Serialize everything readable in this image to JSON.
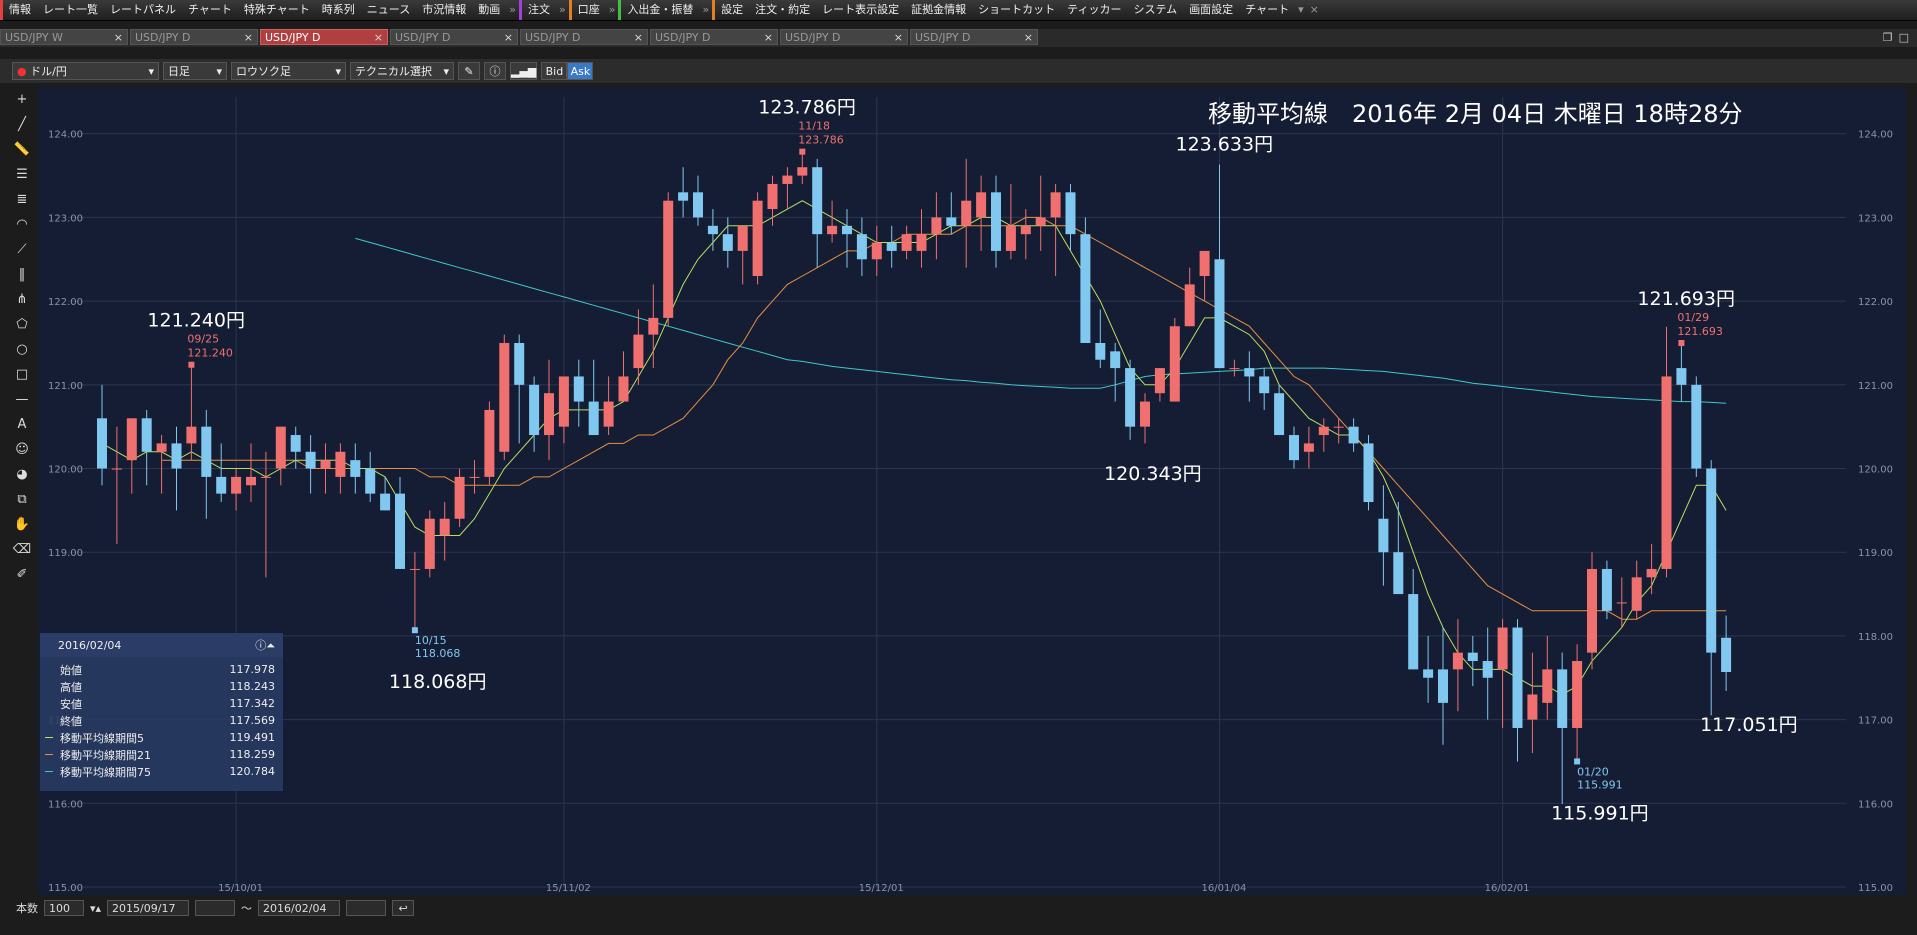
{
  "menu": {
    "items": [
      {
        "label": "情報",
        "accent": "#e04040"
      },
      {
        "label": "レート一覧"
      },
      {
        "label": "レートパネル"
      },
      {
        "label": "チャート"
      },
      {
        "label": "特殊チャート"
      },
      {
        "label": "時系列"
      },
      {
        "label": "ニュース"
      },
      {
        "label": "市況情報"
      },
      {
        "label": "動画"
      },
      {
        "label": "»",
        "sep": true
      },
      {
        "label": "注文",
        "accent": "#a040e0"
      },
      {
        "label": "»",
        "sep": true
      },
      {
        "label": "口座",
        "accent": "#e08020"
      },
      {
        "label": "»",
        "sep": true
      },
      {
        "label": "入出金・振替",
        "accent": "#40c040"
      },
      {
        "label": "»",
        "sep": true
      },
      {
        "label": "設定",
        "accent": "#e08020"
      },
      {
        "label": "注文・約定"
      },
      {
        "label": "レート表示設定"
      },
      {
        "label": "証拠金情報"
      },
      {
        "label": "ショートカット"
      },
      {
        "label": "ティッカー"
      },
      {
        "label": "システム"
      },
      {
        "label": "画面設定"
      },
      {
        "label": "チャート"
      },
      {
        "label": "▾",
        "sep": true
      },
      {
        "label": "×",
        "sep": true
      }
    ]
  },
  "tabs": [
    {
      "label": "USD/JPY W",
      "active": false
    },
    {
      "label": "USD/JPY D",
      "active": false
    },
    {
      "label": "USD/JPY D",
      "active": true
    },
    {
      "label": "USD/JPY D",
      "active": false
    },
    {
      "label": "USD/JPY D",
      "active": false
    },
    {
      "label": "USD/JPY D",
      "active": false
    },
    {
      "label": "USD/JPY D",
      "active": false
    },
    {
      "label": "USD/JPY D",
      "active": false
    }
  ],
  "tab_close": "×",
  "toolbar": {
    "pair": "ドル/円",
    "period": "日足",
    "chart_type": "ロウソク足",
    "technical": "テクニカル選択",
    "bid": "Bid",
    "ask": "Ask"
  },
  "chart_data": {
    "type": "candlestick",
    "title": "移動平均線　2016年 2月 04日 木曜日 18時28分",
    "ylim": [
      115.0,
      124.2
    ],
    "yticks": [
      "124.00",
      "123.00",
      "122.00",
      "121.00",
      "120.00",
      "119.00",
      "118.00",
      "117.00",
      "116.00",
      "115.00"
    ],
    "xticks": [
      {
        "label": "15/10/01",
        "index": 9
      },
      {
        "label": "15/11/02",
        "index": 31
      },
      {
        "label": "15/12/01",
        "index": 52
      },
      {
        "label": "16/01/04",
        "index": 75
      },
      {
        "label": "16/02/01",
        "index": 94
      }
    ],
    "colors": {
      "up": "#f07070",
      "down": "#80c8f0",
      "ma5": "#b8e060",
      "ma21": "#e89040",
      "ma75": "#40c8c8"
    },
    "candles": [
      {
        "o": 120.6,
        "h": 121.0,
        "l": 119.8,
        "c": 120.0
      },
      {
        "o": 120.0,
        "h": 120.5,
        "l": 119.1,
        "c": 120.0
      },
      {
        "o": 120.1,
        "h": 120.6,
        "l": 119.7,
        "c": 120.6
      },
      {
        "o": 120.6,
        "h": 120.7,
        "l": 119.8,
        "c": 120.2
      },
      {
        "o": 120.2,
        "h": 120.4,
        "l": 119.7,
        "c": 120.3
      },
      {
        "o": 120.3,
        "h": 120.5,
        "l": 119.5,
        "c": 120.0
      },
      {
        "o": 120.3,
        "h": 121.24,
        "l": 120.1,
        "c": 120.5
      },
      {
        "o": 120.5,
        "h": 120.7,
        "l": 119.4,
        "c": 119.9
      },
      {
        "o": 119.9,
        "h": 120.3,
        "l": 119.6,
        "c": 119.7
      },
      {
        "o": 119.7,
        "h": 120.0,
        "l": 119.5,
        "c": 119.9
      },
      {
        "o": 119.8,
        "h": 120.3,
        "l": 119.6,
        "c": 119.9
      },
      {
        "o": 119.9,
        "h": 120.2,
        "l": 118.7,
        "c": 119.9
      },
      {
        "o": 120.0,
        "h": 120.5,
        "l": 119.8,
        "c": 120.5
      },
      {
        "o": 120.4,
        "h": 120.5,
        "l": 120.0,
        "c": 120.2
      },
      {
        "o": 120.2,
        "h": 120.4,
        "l": 119.7,
        "c": 120.0
      },
      {
        "o": 120.0,
        "h": 120.3,
        "l": 119.7,
        "c": 120.1
      },
      {
        "o": 119.9,
        "h": 120.3,
        "l": 119.7,
        "c": 120.2
      },
      {
        "o": 120.1,
        "h": 120.3,
        "l": 119.7,
        "c": 119.9
      },
      {
        "o": 120.0,
        "h": 120.2,
        "l": 119.6,
        "c": 119.7
      },
      {
        "o": 119.7,
        "h": 119.9,
        "l": 119.5,
        "c": 119.5
      },
      {
        "o": 119.7,
        "h": 119.9,
        "l": 118.8,
        "c": 118.8
      },
      {
        "o": 118.8,
        "h": 119.0,
        "l": 118.068,
        "c": 118.8
      },
      {
        "o": 118.8,
        "h": 119.5,
        "l": 118.7,
        "c": 119.4
      },
      {
        "o": 119.2,
        "h": 119.6,
        "l": 118.9,
        "c": 119.4
      },
      {
        "o": 119.4,
        "h": 120.0,
        "l": 119.3,
        "c": 119.9
      },
      {
        "o": 119.9,
        "h": 120.1,
        "l": 119.7,
        "c": 119.9
      },
      {
        "o": 119.9,
        "h": 120.8,
        "l": 119.8,
        "c": 120.7
      },
      {
        "o": 120.2,
        "h": 121.6,
        "l": 120.1,
        "c": 121.5
      },
      {
        "o": 121.5,
        "h": 121.6,
        "l": 120.3,
        "c": 121.0
      },
      {
        "o": 121.0,
        "h": 121.1,
        "l": 120.2,
        "c": 120.4
      },
      {
        "o": 120.4,
        "h": 121.3,
        "l": 120.1,
        "c": 120.9
      },
      {
        "o": 120.5,
        "h": 121.1,
        "l": 120.3,
        "c": 121.1
      },
      {
        "o": 121.1,
        "h": 121.3,
        "l": 120.5,
        "c": 120.8
      },
      {
        "o": 120.8,
        "h": 121.3,
        "l": 120.4,
        "c": 120.4
      },
      {
        "o": 120.5,
        "h": 121.1,
        "l": 120.4,
        "c": 120.8
      },
      {
        "o": 120.8,
        "h": 121.4,
        "l": 120.8,
        "c": 121.1
      },
      {
        "o": 121.2,
        "h": 121.9,
        "l": 121.0,
        "c": 121.6
      },
      {
        "o": 121.6,
        "h": 122.2,
        "l": 121.2,
        "c": 121.8
      },
      {
        "o": 121.8,
        "h": 123.3,
        "l": 121.7,
        "c": 123.2
      },
      {
        "o": 123.3,
        "h": 123.6,
        "l": 123.0,
        "c": 123.2
      },
      {
        "o": 123.3,
        "h": 123.5,
        "l": 122.9,
        "c": 123.0
      },
      {
        "o": 122.9,
        "h": 123.1,
        "l": 122.6,
        "c": 122.8
      },
      {
        "o": 122.8,
        "h": 123.0,
        "l": 122.4,
        "c": 122.6
      },
      {
        "o": 122.6,
        "h": 122.8,
        "l": 122.2,
        "c": 122.9
      },
      {
        "o": 122.3,
        "h": 123.3,
        "l": 122.2,
        "c": 123.2
      },
      {
        "o": 123.1,
        "h": 123.5,
        "l": 122.9,
        "c": 123.4
      },
      {
        "o": 123.4,
        "h": 123.6,
        "l": 123.1,
        "c": 123.5
      },
      {
        "o": 123.5,
        "h": 123.786,
        "l": 123.4,
        "c": 123.6
      },
      {
        "o": 123.6,
        "h": 123.7,
        "l": 122.4,
        "c": 122.8
      },
      {
        "o": 122.8,
        "h": 123.2,
        "l": 122.7,
        "c": 122.9
      },
      {
        "o": 122.9,
        "h": 123.1,
        "l": 122.4,
        "c": 122.8
      },
      {
        "o": 122.8,
        "h": 123.0,
        "l": 122.3,
        "c": 122.5
      },
      {
        "o": 122.5,
        "h": 122.9,
        "l": 122.3,
        "c": 122.7
      },
      {
        "o": 122.7,
        "h": 122.9,
        "l": 122.4,
        "c": 122.6
      },
      {
        "o": 122.6,
        "h": 122.9,
        "l": 122.5,
        "c": 122.8
      },
      {
        "o": 122.6,
        "h": 123.1,
        "l": 122.4,
        "c": 122.8
      },
      {
        "o": 122.8,
        "h": 123.3,
        "l": 122.5,
        "c": 123.0
      },
      {
        "o": 123.0,
        "h": 123.3,
        "l": 122.8,
        "c": 122.9
      },
      {
        "o": 122.9,
        "h": 123.7,
        "l": 122.4,
        "c": 123.2
      },
      {
        "o": 123.0,
        "h": 123.5,
        "l": 122.6,
        "c": 123.3
      },
      {
        "o": 123.3,
        "h": 123.5,
        "l": 122.4,
        "c": 122.6
      },
      {
        "o": 122.6,
        "h": 123.4,
        "l": 122.5,
        "c": 122.9
      },
      {
        "o": 122.8,
        "h": 123.1,
        "l": 122.5,
        "c": 122.9
      },
      {
        "o": 122.9,
        "h": 123.5,
        "l": 122.6,
        "c": 123.0
      },
      {
        "o": 123.0,
        "h": 123.4,
        "l": 122.3,
        "c": 123.3
      },
      {
        "o": 123.3,
        "h": 123.4,
        "l": 122.6,
        "c": 122.8
      },
      {
        "o": 122.8,
        "h": 123.0,
        "l": 121.5,
        "c": 121.5
      },
      {
        "o": 121.5,
        "h": 121.9,
        "l": 121.2,
        "c": 121.3
      },
      {
        "o": 121.4,
        "h": 121.5,
        "l": 120.8,
        "c": 121.2
      },
      {
        "o": 121.2,
        "h": 121.3,
        "l": 120.343,
        "c": 120.5
      },
      {
        "o": 120.5,
        "h": 120.9,
        "l": 120.3,
        "c": 120.8
      },
      {
        "o": 120.9,
        "h": 121.2,
        "l": 120.8,
        "c": 121.2
      },
      {
        "o": 120.8,
        "h": 121.8,
        "l": 120.8,
        "c": 121.7
      },
      {
        "o": 121.7,
        "h": 122.4,
        "l": 121.7,
        "c": 122.2
      },
      {
        "o": 122.3,
        "h": 122.6,
        "l": 122.0,
        "c": 122.6
      },
      {
        "o": 122.5,
        "h": 123.633,
        "l": 121.2,
        "c": 121.2
      },
      {
        "o": 121.2,
        "h": 121.3,
        "l": 121.1,
        "c": 121.2
      },
      {
        "o": 121.2,
        "h": 121.4,
        "l": 120.8,
        "c": 121.1
      },
      {
        "o": 121.1,
        "h": 121.2,
        "l": 120.7,
        "c": 120.9
      },
      {
        "o": 120.9,
        "h": 121.0,
        "l": 120.4,
        "c": 120.4
      },
      {
        "o": 120.4,
        "h": 120.5,
        "l": 120.0,
        "c": 120.1
      },
      {
        "o": 120.2,
        "h": 120.5,
        "l": 120.0,
        "c": 120.3
      },
      {
        "o": 120.4,
        "h": 120.6,
        "l": 120.2,
        "c": 120.5
      },
      {
        "o": 120.5,
        "h": 120.6,
        "l": 120.3,
        "c": 120.5
      },
      {
        "o": 120.5,
        "h": 120.6,
        "l": 120.2,
        "c": 120.3
      },
      {
        "o": 120.3,
        "h": 120.4,
        "l": 119.5,
        "c": 119.6
      },
      {
        "o": 119.4,
        "h": 119.8,
        "l": 118.6,
        "c": 119.0
      },
      {
        "o": 119.0,
        "h": 119.6,
        "l": 118.5,
        "c": 118.5
      },
      {
        "o": 118.5,
        "h": 118.8,
        "l": 117.6,
        "c": 117.6
      },
      {
        "o": 117.6,
        "h": 118.0,
        "l": 117.2,
        "c": 117.5
      },
      {
        "o": 117.6,
        "h": 118.1,
        "l": 116.7,
        "c": 117.2
      },
      {
        "o": 117.6,
        "h": 118.2,
        "l": 117.1,
        "c": 117.8
      },
      {
        "o": 117.8,
        "h": 118.0,
        "l": 117.4,
        "c": 117.7
      },
      {
        "o": 117.7,
        "h": 118.1,
        "l": 117.0,
        "c": 117.5
      },
      {
        "o": 117.6,
        "h": 118.2,
        "l": 116.9,
        "c": 118.1
      },
      {
        "o": 118.1,
        "h": 118.2,
        "l": 116.5,
        "c": 116.9
      },
      {
        "o": 117.0,
        "h": 117.8,
        "l": 116.6,
        "c": 117.3
      },
      {
        "o": 117.2,
        "h": 118.0,
        "l": 117.0,
        "c": 117.6
      },
      {
        "o": 117.6,
        "h": 117.8,
        "l": 115.991,
        "c": 116.9
      },
      {
        "o": 116.9,
        "h": 117.9,
        "l": 116.5,
        "c": 117.7
      },
      {
        "o": 117.8,
        "h": 119.0,
        "l": 117.6,
        "c": 118.8
      },
      {
        "o": 118.8,
        "h": 118.9,
        "l": 118.2,
        "c": 118.3
      },
      {
        "o": 118.4,
        "h": 118.7,
        "l": 118.1,
        "c": 118.4
      },
      {
        "o": 118.3,
        "h": 118.9,
        "l": 118.2,
        "c": 118.7
      },
      {
        "o": 118.7,
        "h": 119.1,
        "l": 118.5,
        "c": 118.8
      },
      {
        "o": 118.8,
        "h": 121.693,
        "l": 118.7,
        "c": 121.1
      },
      {
        "o": 121.2,
        "h": 121.5,
        "l": 120.8,
        "c": 121.0
      },
      {
        "o": 121.0,
        "h": 121.1,
        "l": 119.9,
        "c": 120.0
      },
      {
        "o": 120.0,
        "h": 120.1,
        "l": 117.051,
        "c": 117.8
      },
      {
        "o": 117.978,
        "h": 118.243,
        "l": 117.342,
        "c": 117.569
      }
    ],
    "ma5": [
      120.3,
      120.2,
      120.1,
      120.2,
      120.2,
      120.1,
      120.2,
      120.1,
      120.0,
      120.0,
      120.0,
      119.9,
      120.0,
      120.1,
      120.1,
      120.1,
      120.1,
      120.0,
      120.0,
      119.9,
      119.6,
      119.3,
      119.2,
      119.2,
      119.2,
      119.4,
      119.7,
      120.0,
      120.2,
      120.4,
      120.6,
      120.7,
      120.7,
      120.7,
      120.7,
      120.8,
      121.1,
      121.4,
      121.8,
      122.2,
      122.5,
      122.7,
      122.9,
      122.9,
      122.9,
      123.0,
      123.1,
      123.2,
      123.1,
      123.0,
      122.9,
      122.8,
      122.7,
      122.7,
      122.7,
      122.7,
      122.8,
      122.9,
      122.9,
      123.0,
      123.0,
      122.9,
      122.9,
      122.9,
      122.9,
      122.6,
      122.3,
      122.0,
      121.6,
      121.2,
      121.0,
      121.0,
      121.2,
      121.5,
      121.8,
      121.8,
      121.7,
      121.6,
      121.4,
      121.0,
      120.8,
      120.6,
      120.5,
      120.4,
      120.4,
      120.2,
      119.9,
      119.5,
      119.0,
      118.5,
      118.1,
      117.8,
      117.6,
      117.6,
      117.6,
      117.5,
      117.4,
      117.4,
      117.3,
      117.4,
      117.7,
      117.9,
      118.1,
      118.4,
      118.6,
      119.0,
      119.4,
      119.8,
      119.8,
      119.5
    ],
    "ma21": [
      120.1,
      120.1,
      120.1,
      120.1,
      120.1,
      120.1,
      120.1,
      120.1,
      120.1,
      120.1,
      120.0,
      120.0,
      120.0,
      120.0,
      120.0,
      120.0,
      120.0,
      120.0,
      119.9,
      119.9,
      119.8,
      119.8,
      119.8,
      119.8,
      119.8,
      119.9,
      119.9,
      120.0,
      120.1,
      120.2,
      120.3,
      120.3,
      120.4,
      120.4,
      120.5,
      120.6,
      120.8,
      121.0,
      121.3,
      121.5,
      121.8,
      122.0,
      122.2,
      122.3,
      122.4,
      122.5,
      122.6,
      122.6,
      122.7,
      122.7,
      122.8,
      122.8,
      122.8,
      122.8,
      122.9,
      122.9,
      122.9,
      122.9,
      123.0,
      123.0,
      122.9,
      122.9,
      122.8,
      122.7,
      122.6,
      122.5,
      122.4,
      122.3,
      122.2,
      122.1,
      122.0,
      121.9,
      121.8,
      121.7,
      121.5,
      121.3,
      121.1,
      121.0,
      120.8,
      120.6,
      120.4,
      120.2,
      120.0,
      119.8,
      119.6,
      119.4,
      119.2,
      119.0,
      118.8,
      118.6,
      118.5,
      118.4,
      118.3,
      118.3,
      118.3,
      118.3,
      118.3,
      118.3,
      118.2,
      118.2,
      118.3,
      118.3,
      118.3,
      118.3,
      118.3,
      118.3
    ],
    "ma75": [
      122.75,
      122.7,
      122.65,
      122.6,
      122.55,
      122.5,
      122.45,
      122.4,
      122.35,
      122.3,
      122.25,
      122.2,
      122.15,
      122.1,
      122.05,
      122.0,
      121.95,
      121.9,
      121.85,
      121.8,
      121.75,
      121.7,
      121.65,
      121.6,
      121.55,
      121.5,
      121.45,
      121.4,
      121.35,
      121.3,
      121.28,
      121.25,
      121.22,
      121.2,
      121.18,
      121.16,
      121.14,
      121.12,
      121.1,
      121.08,
      121.06,
      121.05,
      121.03,
      121.02,
      121.0,
      120.99,
      120.98,
      120.97,
      120.96,
      120.96,
      120.96,
      121.0,
      121.05,
      121.1,
      121.12,
      121.13,
      121.14,
      121.15,
      121.16,
      121.17,
      121.18,
      121.2,
      121.2,
      121.2,
      121.2,
      121.2,
      121.19,
      121.18,
      121.17,
      121.16,
      121.14,
      121.12,
      121.1,
      121.08,
      121.05,
      121.02,
      121.0,
      120.98,
      120.96,
      120.94,
      120.92,
      120.9,
      120.88,
      120.86,
      120.85,
      120.84,
      120.83,
      120.82,
      120.81,
      120.8,
      120.8,
      120.79,
      120.78
    ],
    "annotations": [
      {
        "idx": 6,
        "kind": "high",
        "date": "09/25",
        "value": "121.240",
        "big": "121.240円",
        "color": "#f07070"
      },
      {
        "idx": 21,
        "kind": "low",
        "date": "10/15",
        "value": "118.068",
        "big": "118.068円",
        "color": "#80c8f0"
      },
      {
        "idx": 47,
        "kind": "high",
        "date": "11/18",
        "value": "123.786",
        "big": "123.786円",
        "color": "#f07070"
      },
      {
        "idx": 69,
        "kind": "low",
        "big": "120.343円"
      },
      {
        "idx": 75,
        "kind": "high",
        "big": "123.633円"
      },
      {
        "idx": 99,
        "kind": "low",
        "date": "01/20",
        "value": "115.991",
        "big": "115.991円",
        "color": "#80c8f0"
      },
      {
        "idx": 106,
        "kind": "high",
        "date": "01/29",
        "value": "121.693",
        "big": "121.693円",
        "color": "#f07070"
      },
      {
        "idx": 109,
        "kind": "low",
        "big": "117.051円"
      }
    ]
  },
  "info_panel": {
    "date": "2016/02/04",
    "rows": [
      {
        "label": "始値",
        "value": "117.978"
      },
      {
        "label": "高値",
        "value": "118.243"
      },
      {
        "label": "安値",
        "value": "117.342"
      },
      {
        "label": "終値",
        "value": "117.569"
      },
      {
        "label": "移動平均線期間5",
        "value": "119.491",
        "color": "#b8e060"
      },
      {
        "label": "移動平均線期間21",
        "value": "118.259",
        "color": "#e89040"
      },
      {
        "label": "移動平均線期間75",
        "value": "120.784",
        "color": "#40c8c8"
      }
    ]
  },
  "bottom": {
    "count_label": "本数",
    "count": "100",
    "from": "2015/09/17",
    "tilde": "〜",
    "to": "2016/02/04"
  }
}
